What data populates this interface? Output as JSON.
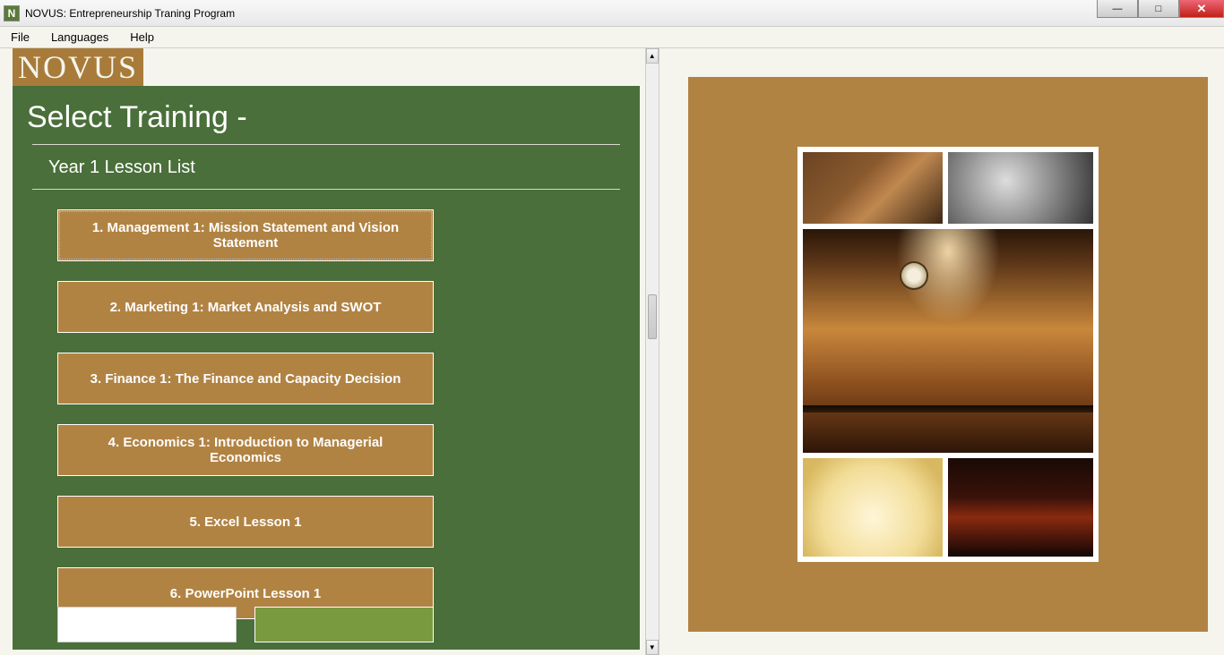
{
  "window": {
    "title": "NOVUS: Entrepreneurship Traning Program",
    "icon_letter": "N"
  },
  "menu": {
    "items": [
      "File",
      "Languages",
      "Help"
    ]
  },
  "logo": "NOVUS",
  "main": {
    "heading": "Select Training -",
    "subheading": "Year 1 Lesson List",
    "lessons": [
      {
        "label": "1. Management 1: Mission Statement and Vision Statement",
        "selected": true
      },
      {
        "label": "2. Marketing 1: Market Analysis and SWOT",
        "selected": false
      },
      {
        "label": "3. Finance 1: The Finance and Capacity Decision",
        "selected": false
      },
      {
        "label": "4. Economics 1: Introduction to Managerial Economics",
        "selected": false
      },
      {
        "label": "5. Excel Lesson 1",
        "selected": false
      },
      {
        "label": "6. PowerPoint Lesson 1",
        "selected": false
      }
    ]
  }
}
